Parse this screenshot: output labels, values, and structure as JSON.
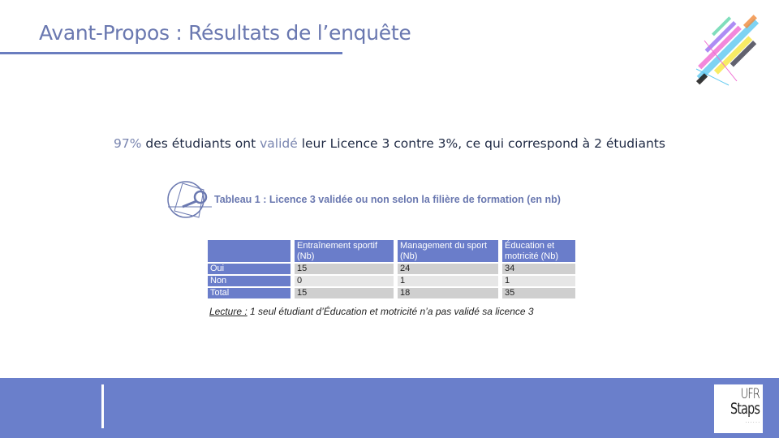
{
  "header": {
    "title": "Avant-Propos : Résultats de l’enquête"
  },
  "summary": {
    "highlight_percent": "97%",
    "part1": " des étudiants ont ",
    "highlight_word": "validé",
    "part2": " leur Licence 3 contre 3%, ce qui correspond à 2 étudiants"
  },
  "table_caption": "Tableau 1 : Licence 3 validée ou non selon la filière de formation (en nb)",
  "table": {
    "columns": [
      "",
      "Entraînement sportif (Nb)",
      "Management du sport (Nb)",
      "Éducation et motricité (Nb)"
    ],
    "rows": [
      {
        "label": "Oui",
        "values": [
          "15",
          "24",
          "34"
        ]
      },
      {
        "label": "Non",
        "values": [
          "0",
          "1",
          "1"
        ]
      },
      {
        "label": "Total",
        "values": [
          "15",
          "18",
          "35"
        ]
      }
    ]
  },
  "lecture": {
    "label": "Lecture :",
    "text": " 1 seul étudiant d’Éducation et motricité n’a pas validé sa licence 3"
  },
  "footer": {
    "logo_line1": "UFR",
    "logo_line2": "Staps",
    "logo_line3": "· · · · · ·"
  },
  "colors": {
    "accent": "#6a7fcb",
    "title": "#6a78b0",
    "table_odd": "#cfcfcf",
    "table_even": "#e6e6e6"
  },
  "icons": {
    "caption_icon": "magnifier-icon",
    "decoration": "abstract-geometric-decoration"
  }
}
